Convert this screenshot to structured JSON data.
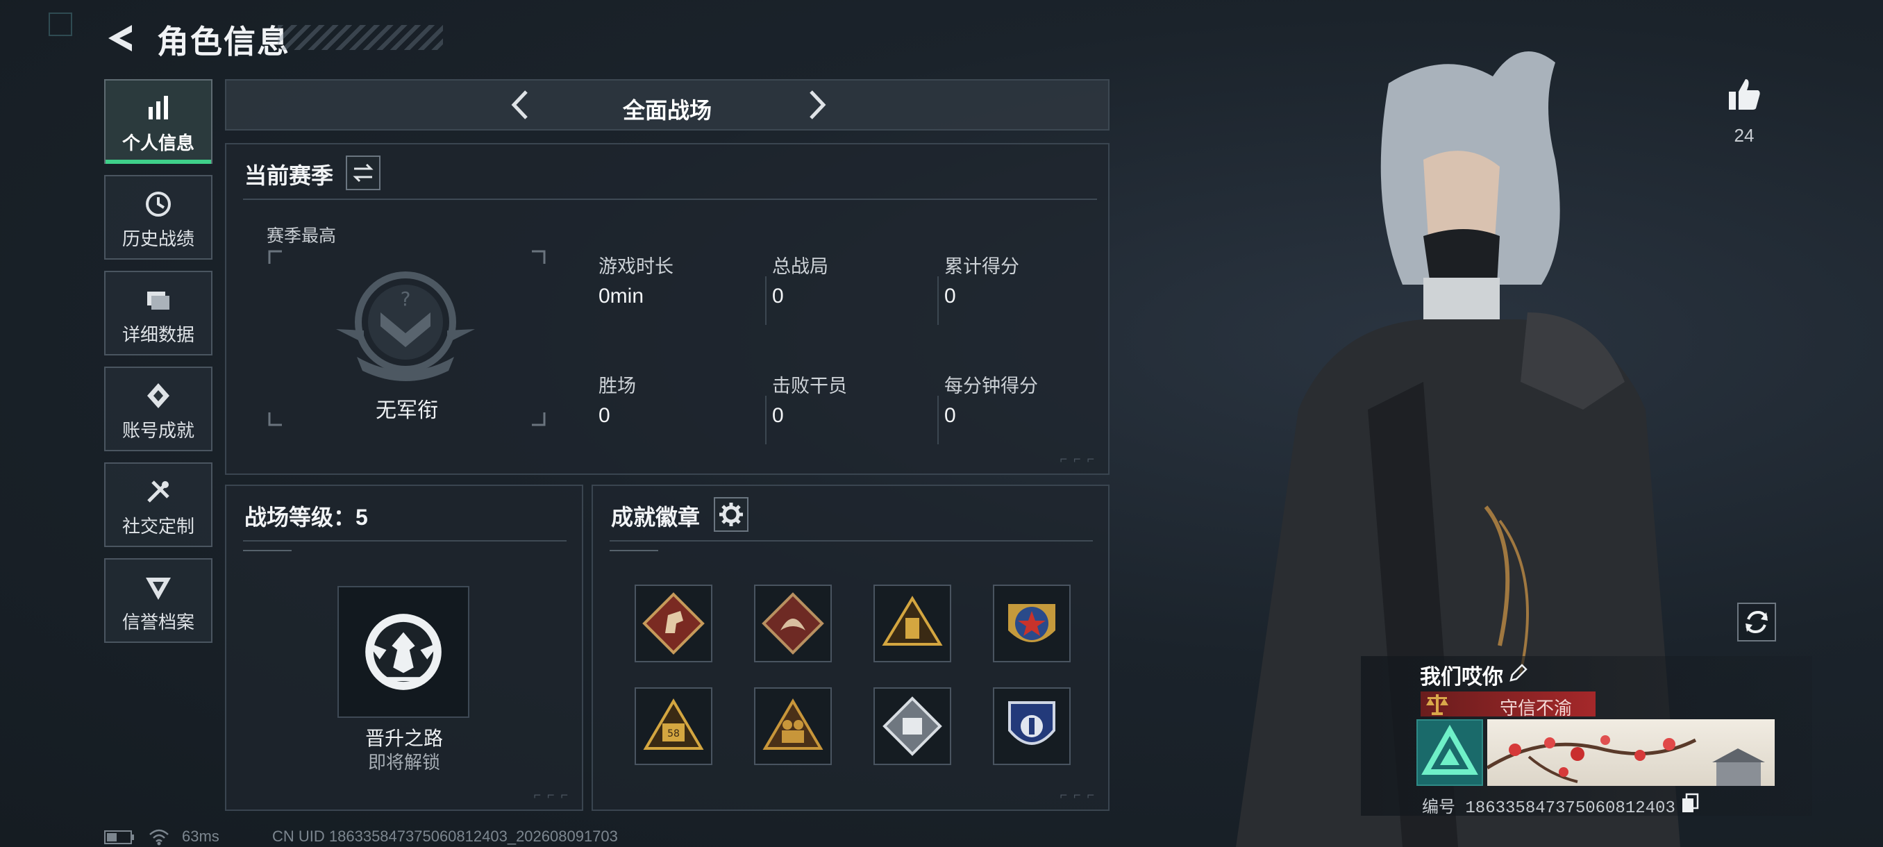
{
  "header": {
    "title": "角色信息"
  },
  "sidebar": {
    "items": [
      {
        "label": "个人信息",
        "icon": "bar-chart-icon",
        "active": true
      },
      {
        "label": "历史战绩",
        "icon": "history-icon"
      },
      {
        "label": "详细数据",
        "icon": "folder-icon"
      },
      {
        "label": "账号成就",
        "icon": "achievement-icon"
      },
      {
        "label": "社交定制",
        "icon": "tools-icon"
      },
      {
        "label": "信誉档案",
        "icon": "reputation-icon"
      }
    ]
  },
  "mode": {
    "title": "全面战场"
  },
  "season": {
    "title": "当前赛季",
    "best_label": "赛季最高",
    "rank_name": "无军衔",
    "stats": [
      {
        "label": "游戏时长",
        "value": "0min"
      },
      {
        "label": "总战局",
        "value": "0"
      },
      {
        "label": "累计得分",
        "value": "0"
      },
      {
        "label": "胜场",
        "value": "0"
      },
      {
        "label": "击败干员",
        "value": "0"
      },
      {
        "label": "每分钟得分",
        "value": "0"
      }
    ]
  },
  "battlefield_level": {
    "title": "战场等级：5",
    "path_name": "晋升之路",
    "path_status": "即将解锁"
  },
  "achievements": {
    "title": "成就徽章",
    "badges": [
      "horse-badge-icon",
      "dragon-badge-icon",
      "pyramid-gold-badge-icon",
      "star-medal-badge-icon",
      "pyramid-58-badge-icon",
      "soldiers-badge-icon",
      "silver-diamond-badge-icon",
      "blue-shield-badge-icon"
    ]
  },
  "profile": {
    "likes": "24",
    "player_name": "我们哎你",
    "honor_title": "守信不渝",
    "uid_line": "编号 1863358473750608124​03"
  },
  "status_bar": {
    "ping": "63ms",
    "cn_uid": "CN UID 1863358473750608124​03_202608091703"
  },
  "colors": {
    "accent_green": "#3fd08a",
    "honor_red": "#a5282a"
  }
}
